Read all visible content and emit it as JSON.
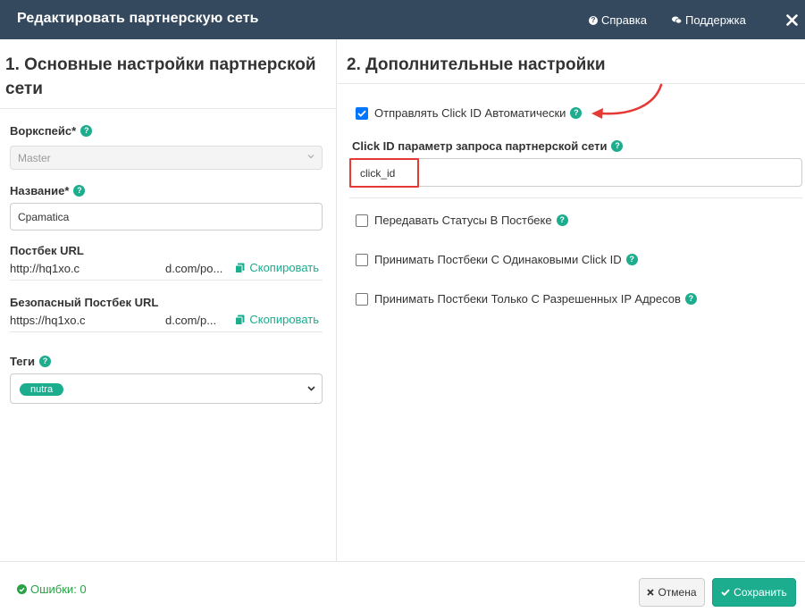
{
  "header": {
    "title": "Редактировать партнерскую сеть",
    "help_label": "Справка",
    "support_label": "Поддержка"
  },
  "left": {
    "title": "1. Основные настройки партнерской сети",
    "workspace": {
      "label": "Воркспейс*",
      "value": "Master"
    },
    "name": {
      "label": "Название*",
      "value": "Cpamatica"
    },
    "postback": {
      "label": "Постбек URL",
      "value_start": "http://hq1xo.c",
      "value_end": "d.com/po...",
      "copy_label": "Скопировать"
    },
    "secure_postback": {
      "label": "Безопасный Постбек URL",
      "value_start": "https://hq1xo.c",
      "value_end": "d.com/p...",
      "copy_label": "Скопировать"
    },
    "tags": {
      "label": "Теги",
      "selected": "nutra"
    }
  },
  "right": {
    "title": "2. Дополнительные настройки",
    "auto_click_id": {
      "label": "Отправлять Click ID Автоматически",
      "checked": true
    },
    "click_param": {
      "label": "Click ID параметр запроса партнерской сети",
      "value": "click_id"
    },
    "pass_statuses": {
      "label": "Передавать Статусы В Постбеке",
      "checked": false
    },
    "same_click_id": {
      "label": "Принимать Постбеки С Одинаковыми Click ID",
      "checked": false
    },
    "allowed_ip": {
      "label": "Принимать Постбеки Только С Разрешенных IP Адресов",
      "checked": false
    }
  },
  "footer": {
    "errors_label": "Ошибки: 0",
    "cancel_label": "Отмена",
    "save_label": "Сохранить"
  },
  "colors": {
    "header_bg": "#34495e",
    "accent": "#1cac8e",
    "highlight": "#e53935",
    "success": "#27a244"
  }
}
